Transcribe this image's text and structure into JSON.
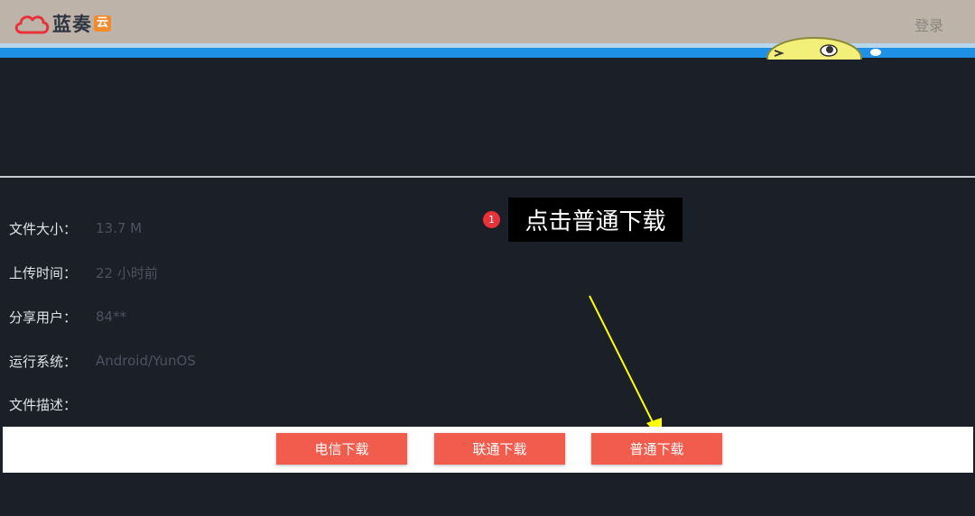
{
  "header": {
    "logo_text": "蓝奏",
    "logo_badge": "云",
    "login_label": "登录",
    "logo_color": "#e8323a",
    "blue_bar_color": "#1e90e6"
  },
  "file_info": [
    {
      "label": "文件大小：",
      "value": "13.7 M"
    },
    {
      "label": "上传时间：",
      "value": "22 小时前"
    },
    {
      "label": "分享用户：",
      "value": "84**"
    },
    {
      "label": "运行系统：",
      "value": "Android/YunOS"
    },
    {
      "label": "文件描述：",
      "value": ""
    }
  ],
  "annotation": {
    "step_number": "1",
    "text": "点击普通下载",
    "arrow_color": "#ffff00"
  },
  "buttons": {
    "telecom": "电信下载",
    "unicom": "联通下载",
    "normal": "普通下载",
    "color": "#f25c4c"
  }
}
